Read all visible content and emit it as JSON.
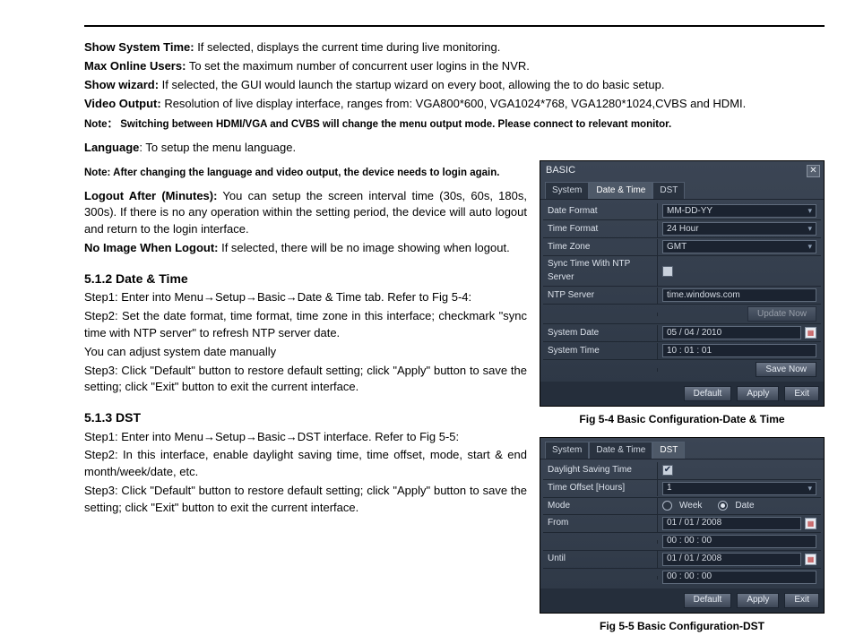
{
  "paras": {
    "show_system_time_b": "Show System Time:",
    "show_system_time_t": " If selected, displays the current time during live monitoring.",
    "max_online_b": "Max Online Users:",
    "max_online_t": " To set the maximum number of concurrent user logins in the NVR.",
    "show_wizard_b": "Show wizard:",
    "show_wizard_t": " If selected, the GUI would launch the startup wizard on every boot, allowing the   to do basic setup.",
    "video_output_b": "Video Output:",
    "video_output_t": " Resolution of live display interface, ranges from: VGA800*600, VGA1024*768, VGA1280*1024,CVBS and HDMI.",
    "note1_b": "Note：",
    "note1_t": "Switching between HDMI/VGA and CVBS will change the menu output mode. Please connect to relevant monitor.",
    "language_b": "Language",
    "language_t": ": To setup the menu language.",
    "note2_b": "Note:",
    "note2_t": " After changing the language and video output, the device needs to login again.",
    "logout_b": "Logout After (Minutes):",
    "logout_t": " You can setup the screen interval time (30s, 60s, 180s, 300s). If there is no any operation within the setting period, the device will auto logout and return to the login interface.",
    "noimage_b": "No Image When Logout:",
    "noimage_t": " If selected, there will be no image showing when logout.",
    "s512_title": "5.1.2  Date & Time",
    "s512_step1_a": "Step1: Enter into Menu",
    "s512_step1_b": "Setup",
    "s512_step1_c": "Basic",
    "s512_step1_d": "Date & Time tab. Refer to Fig 5-4:",
    "s512_step2": "Step2: Set the date format, time format, time zone in this interface; checkmark \"sync time with NTP server\" to refresh NTP server date.",
    "s512_adj": "You can adjust system date manually",
    "s512_step3a": "Step3: Click \"Default\" button to restore default setting; click \"Apply\" button to save the setting; click \"Exit\" button to exit the current interface.",
    "s513_title": "5.1.3  DST",
    "s513_step1_a": "Step1: Enter into Menu",
    "s513_step1_b": "Setup",
    "s513_step1_c": "Basic",
    "s513_step1_d": "DST interface. Refer to Fig 5-5:",
    "s513_step2": "Step2: In this interface, enable daylight saving time, time offset, mode, start & end month/week/date, etc.",
    "s513_step3": "Step3: Click \"Default\" button to restore default setting; click \"Apply\" button to save the setting; click \"Exit\" button to exit the current interface."
  },
  "fig54": {
    "title": "BASIC",
    "tabs": {
      "t1": "System",
      "t2": "Date & Time",
      "t3": "DST"
    },
    "rows": {
      "date_format_l": "Date Format",
      "date_format_v": "MM-DD-YY",
      "time_format_l": "Time Format",
      "time_format_v": "24 Hour",
      "time_zone_l": "Time Zone",
      "time_zone_v": "GMT",
      "sync_l": "Sync Time With NTP Server",
      "ntp_l": "NTP Server",
      "ntp_v": "time.windows.com",
      "update_btn": "Update Now",
      "sys_date_l": "System Date",
      "sys_date_v": "05 / 04 / 2010",
      "sys_time_l": "System Time",
      "sys_time_v": "10  :  01  :  01",
      "save_btn": "Save Now"
    },
    "actions": {
      "default": "Default",
      "apply": "Apply",
      "exit": "Exit"
    },
    "caption": "Fig 5-4 Basic Configuration-Date & Time"
  },
  "fig55": {
    "tabs": {
      "t1": "System",
      "t2": "Date & Time",
      "t3": "DST"
    },
    "rows": {
      "dst_l": "Daylight Saving Time",
      "offset_l": "Time Offset [Hours]",
      "offset_v": "1",
      "mode_l": "Mode",
      "mode_week": "Week",
      "mode_date": "Date",
      "from_l": "From",
      "from_date": "01 / 01 / 2008",
      "from_time": "00  :  00  :  00",
      "until_l": "Until",
      "until_date": "01 / 01 / 2008",
      "until_time": "00  :  00  :  00"
    },
    "actions": {
      "default": "Default",
      "apply": "Apply",
      "exit": "Exit"
    },
    "caption": "Fig 5-5 Basic Configuration-DST"
  },
  "glyphs": {
    "arrow": "→",
    "x": "✕",
    "check": "✔",
    "carat": "▾",
    "cal": "▦"
  }
}
